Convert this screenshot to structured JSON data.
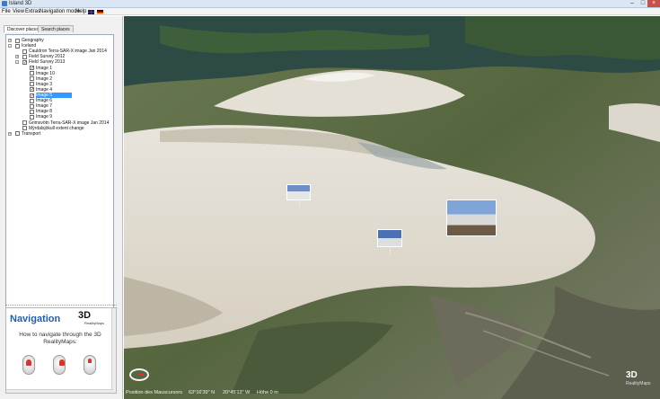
{
  "window": {
    "title": "Island 3D"
  },
  "menu": {
    "items": [
      "File",
      "View",
      "Extras",
      "Navigation mode",
      "Help"
    ]
  },
  "leftpanel": {
    "tabs": [
      "Discover places",
      "Search places"
    ],
    "tree": [
      {
        "label": "Geography",
        "level": 0,
        "expander": "+",
        "checked": false
      },
      {
        "label": "Iceland",
        "level": 0,
        "expander": "-",
        "checked": false
      },
      {
        "label": "Cauldron Terra-SAR-X image Jan 2014",
        "level": 1,
        "expander": "",
        "checked": false
      },
      {
        "label": "Field Survey 2012",
        "level": 1,
        "expander": "+",
        "checked": false
      },
      {
        "label": "Field Survey 2013",
        "level": 1,
        "expander": "-",
        "checked": true
      },
      {
        "label": "Image 1",
        "level": 2,
        "expander": "",
        "checked": true
      },
      {
        "label": "Image 10",
        "level": 2,
        "expander": "",
        "checked": false
      },
      {
        "label": "Image 2",
        "level": 2,
        "expander": "",
        "checked": false
      },
      {
        "label": "Image 3",
        "level": 2,
        "expander": "",
        "checked": false
      },
      {
        "label": "Image 4",
        "level": 2,
        "expander": "",
        "checked": true
      },
      {
        "label": "Image 5",
        "level": 2,
        "expander": "",
        "checked": true,
        "selected": true
      },
      {
        "label": "Image 6",
        "level": 2,
        "expander": "",
        "checked": false
      },
      {
        "label": "Image 7",
        "level": 2,
        "expander": "",
        "checked": false
      },
      {
        "label": "Image 8",
        "level": 2,
        "expander": "",
        "checked": false
      },
      {
        "label": "Image 9",
        "level": 2,
        "expander": "",
        "checked": false
      },
      {
        "label": "Grimsvötn Terra-SAR-X image Jan 2014",
        "level": 1,
        "expander": "",
        "checked": false
      },
      {
        "label": "Mýrdalsjökull extent change",
        "level": 1,
        "expander": "",
        "checked": false
      },
      {
        "label": "Transport",
        "level": 0,
        "expander": "+",
        "checked": false
      }
    ]
  },
  "navpanel": {
    "title": "Navigation",
    "logo_number": "3D",
    "logo_brand": "RealityMaps",
    "instructions": "How to navigate through the 3D RealityMaps:"
  },
  "statusbar": {
    "position_label": "Position des Mauscursors",
    "latitude": "63°16'39\" N",
    "longitude": "20°45'13\" W",
    "height": "Höhe 0 m"
  },
  "watermark": {
    "number": "3D",
    "brand": "RealityMaps"
  },
  "icons": {
    "app": "app-icon",
    "minimize": "minimize-icon",
    "maximize": "maximize-icon",
    "close": "close-icon",
    "compass": "compass-icon"
  },
  "colors": {
    "accent": "#1e5fb6",
    "selection": "#3399ff",
    "glacier": "#d9d4c8"
  }
}
